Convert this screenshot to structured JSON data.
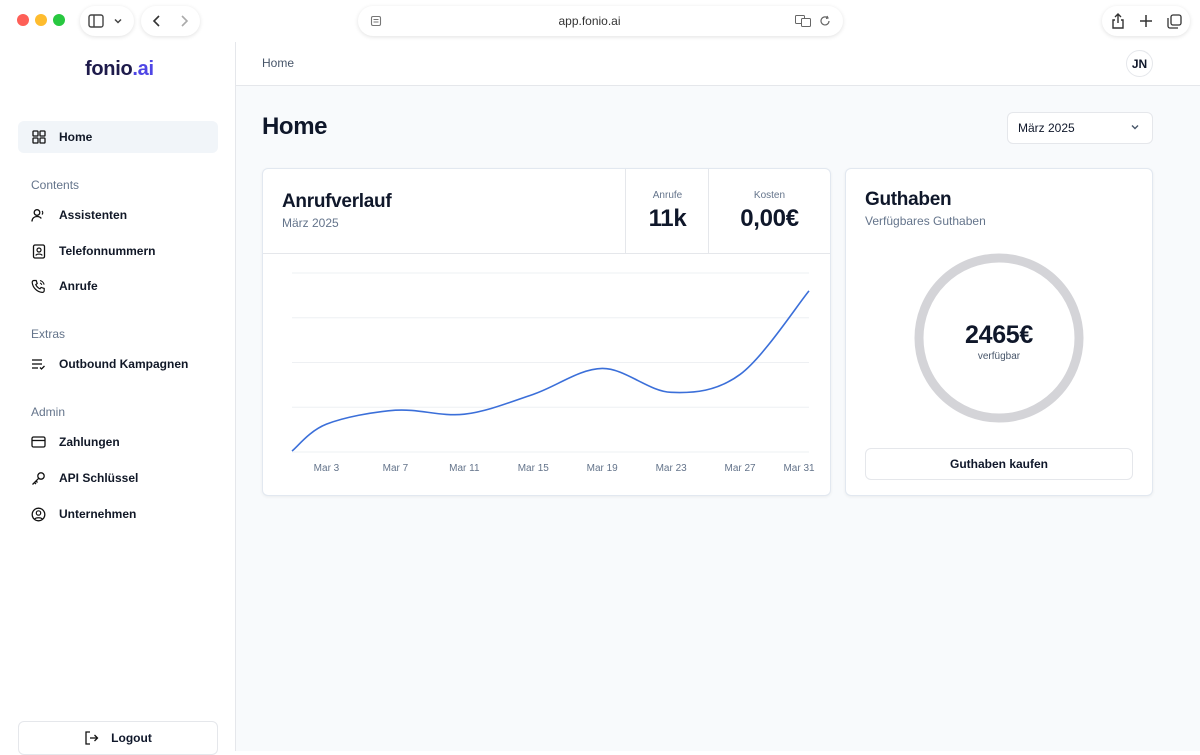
{
  "browser": {
    "url": "app.fonio.ai"
  },
  "sidebar": {
    "logo": {
      "main": "fonio",
      "suffix": ".ai"
    },
    "home_label": "Home",
    "sections": {
      "contents": "Contents",
      "extras": "Extras",
      "admin": "Admin"
    },
    "items": {
      "assistenten": "Assistenten",
      "telefonnummern": "Telefonnummern",
      "anrufe": "Anrufe",
      "outbound": "Outbound Kampagnen",
      "zahlungen": "Zahlungen",
      "api": "API Schlüssel",
      "unternehmen": "Unternehmen"
    },
    "logout_label": "Logout"
  },
  "header": {
    "breadcrumb": "Home",
    "avatar_initials": "JN"
  },
  "page": {
    "title": "Home",
    "month_select": "März 2025"
  },
  "call_card": {
    "title": "Anrufverlauf",
    "subtitle": "März 2025",
    "calls_label": "Anrufe",
    "calls_value": "11k",
    "cost_label": "Kosten",
    "cost_value": "0,00€"
  },
  "balance_card": {
    "title": "Guthaben",
    "subtitle": "Verfügbares Guthaben",
    "amount": "2465€",
    "amount_label": "verfügbar",
    "buy_label": "Guthaben kaufen",
    "ring_color": "#d4d4d8"
  },
  "colors": {
    "accent": "#4f46e5",
    "line": "#3b6fd9"
  },
  "chart_data": {
    "type": "line",
    "title": "",
    "xlabel": "",
    "ylabel": "",
    "tick_labels": [
      "Mar 3",
      "Mar 7",
      "Mar 11",
      "Mar 15",
      "Mar 19",
      "Mar 23",
      "Mar 27",
      "Mar 31"
    ],
    "x": [
      1,
      3,
      7,
      11,
      15,
      19,
      23,
      27,
      31
    ],
    "values": [
      1,
      28,
      42,
      38,
      58,
      84,
      60,
      78,
      162
    ],
    "ylim": [
      0,
      180
    ],
    "grid": true,
    "series": [
      {
        "values": [
          1,
          28,
          42,
          38,
          58,
          84,
          60,
          78,
          162
        ]
      }
    ]
  }
}
